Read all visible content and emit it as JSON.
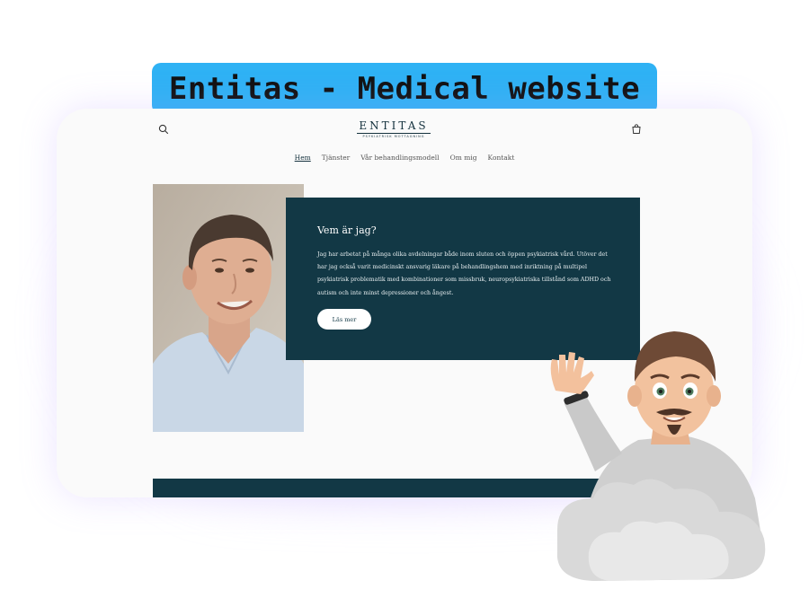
{
  "title_pill": {
    "text": "Entitas - Medical website"
  },
  "site": {
    "logo": {
      "name": "ENTITAS",
      "tagline": "PSYKIATRISK MOTTAGNING"
    },
    "nav": [
      {
        "label": "Hem",
        "active": true
      },
      {
        "label": "Tjänster",
        "active": false
      },
      {
        "label": "Vår behandlingsmodell",
        "active": false
      },
      {
        "label": "Om mig",
        "active": false
      },
      {
        "label": "Kontakt",
        "active": false
      }
    ],
    "header_icons": {
      "search": "search-icon",
      "cart": "cart-icon"
    }
  },
  "hero": {
    "heading": "Vem är jag?",
    "body": "Jag har arbetat på många olika avdelningar både inom sluten och öppen psykiatrisk vård. Utöver det har jag också varit medicinskt ansvarig läkare på behandlingshem med inriktning på multipel psykiatrisk problematik med kombinationer som missbruk, neuropsykiatriska tillstånd som ADHD och autism och inte minst depressioner och ångest.",
    "button": "Läs mer"
  },
  "colors": {
    "accent_pill": "#2fb2f4",
    "brand_teal": "#123845",
    "page_bg": "#fafafa"
  }
}
